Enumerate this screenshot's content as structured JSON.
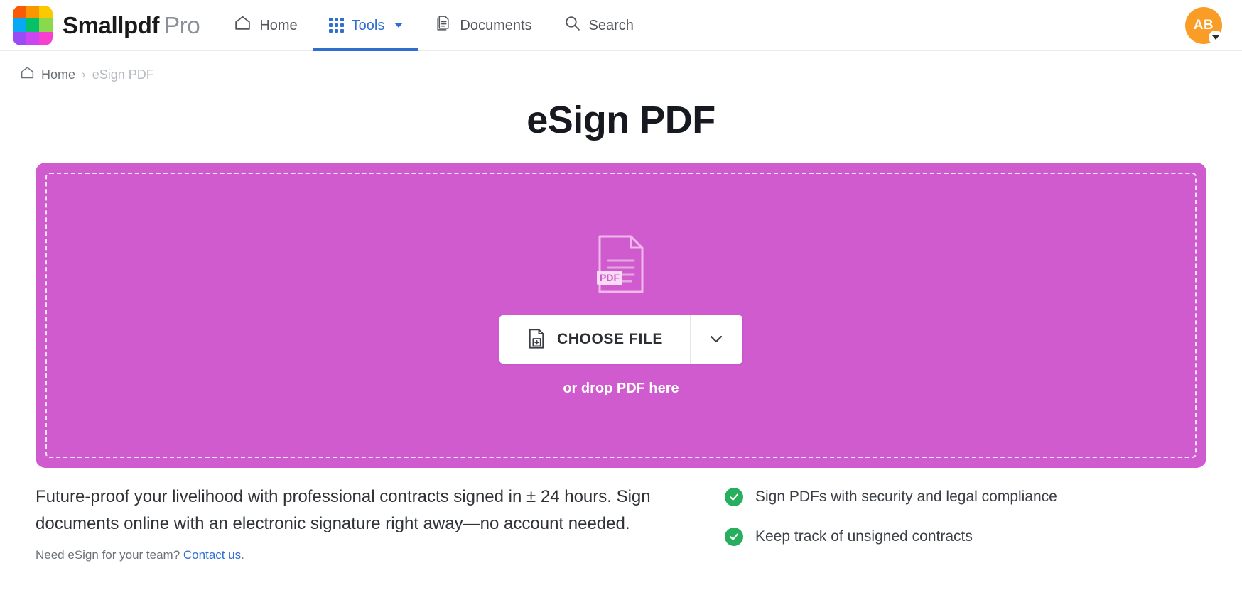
{
  "header": {
    "brand_name": "Smallpdf",
    "brand_plan": "Pro",
    "logo_colors": [
      "#f95a05",
      "#fa9600",
      "#fcc800",
      "#08a8f4",
      "#06c167",
      "#8ad84b",
      "#9b4bf5",
      "#cc45f0",
      "#f73fd0"
    ],
    "nav": [
      {
        "label": "Home",
        "icon": "home-icon",
        "active": false
      },
      {
        "label": "Tools",
        "icon": "grid-icon",
        "active": true,
        "caret": "chevron-down-icon"
      },
      {
        "label": "Documents",
        "icon": "documents-icon",
        "active": false
      },
      {
        "label": "Search",
        "icon": "search-icon",
        "active": false
      }
    ],
    "avatar": {
      "initials": "AB",
      "color": "#f99d27",
      "caret_icon": "chevron-down-icon"
    },
    "accent_color": "#2f6fd0"
  },
  "breadcrumb": {
    "home_icon": "home-icon",
    "items": [
      {
        "label": "Home",
        "current": false
      },
      {
        "label": "eSign PDF",
        "current": true
      }
    ],
    "separator": "›"
  },
  "page": {
    "title": "eSign PDF"
  },
  "dropzone": {
    "background_color": "#cf5bcf",
    "file_icon": "pdf-file-icon",
    "file_icon_label": "PDF",
    "choose_file_label": "CHOOSE FILE",
    "choose_file_icon": "file-add-icon",
    "dropdown_icon": "chevron-down-icon",
    "drop_hint": "or drop PDF here"
  },
  "description": {
    "lead": "Future-proof your livelihood with professional contracts signed in ± 24 hours. Sign documents online with an electronic signature right away—no account needed.",
    "team_prompt": "Need eSign for your team?",
    "team_link": "Contact us",
    "team_suffix": "."
  },
  "features": {
    "check_color": "#27ae5f",
    "items": [
      {
        "label": "Sign PDFs with security and legal compliance"
      },
      {
        "label": "Keep track of unsigned contracts"
      }
    ]
  }
}
